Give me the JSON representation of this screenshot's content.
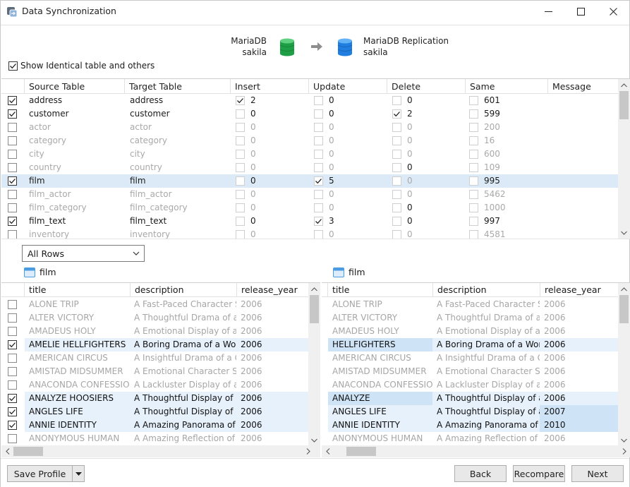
{
  "window": {
    "title": "Data Synchronization"
  },
  "source": {
    "server": "MariaDB",
    "database": "sakila",
    "color": "#1e9f46"
  },
  "target": {
    "server": "MariaDB Replication",
    "database": "sakila",
    "color": "#1f7ee0"
  },
  "show_identical_label": "Show Identical table and others",
  "show_identical_checked": true,
  "table_columns": [
    "Source Table",
    "Target Table",
    "Insert",
    "Update",
    "Delete",
    "Same",
    "Message"
  ],
  "tables": [
    {
      "checked": true,
      "source": "address",
      "target": "address",
      "insert": "2",
      "insert_checked": true,
      "update": "0",
      "update_checked": false,
      "delete": "0",
      "delete_checked": false,
      "same": "601",
      "dim": false,
      "selected": false,
      "delete_dim": false
    },
    {
      "checked": true,
      "source": "customer",
      "target": "customer",
      "insert": "0",
      "insert_checked": false,
      "update": "0",
      "update_checked": false,
      "delete": "2",
      "delete_checked": true,
      "same": "599",
      "dim": false,
      "selected": false,
      "delete_dim": false
    },
    {
      "checked": false,
      "source": "actor",
      "target": "actor",
      "insert": "0",
      "insert_checked": false,
      "update": "0",
      "update_checked": false,
      "delete": "0",
      "delete_checked": false,
      "same": "200",
      "dim": true,
      "selected": false,
      "delete_dim": true
    },
    {
      "checked": false,
      "source": "category",
      "target": "category",
      "insert": "0",
      "insert_checked": false,
      "update": "0",
      "update_checked": false,
      "delete": "0",
      "delete_checked": false,
      "same": "16",
      "dim": true,
      "selected": false,
      "delete_dim": true
    },
    {
      "checked": false,
      "source": "city",
      "target": "city",
      "insert": "0",
      "insert_checked": false,
      "update": "0",
      "update_checked": false,
      "delete": "0",
      "delete_checked": false,
      "same": "600",
      "dim": true,
      "selected": false,
      "delete_dim": true
    },
    {
      "checked": false,
      "source": "country",
      "target": "country",
      "insert": "0",
      "insert_checked": false,
      "update": "0",
      "update_checked": false,
      "delete": "0",
      "delete_checked": false,
      "same": "109",
      "dim": true,
      "selected": false,
      "delete_dim": false
    },
    {
      "checked": true,
      "source": "film",
      "target": "film",
      "insert": "0",
      "insert_checked": false,
      "update": "5",
      "update_checked": true,
      "delete": "0",
      "delete_checked": false,
      "same": "995",
      "dim": false,
      "selected": true,
      "delete_dim": true
    },
    {
      "checked": false,
      "source": "film_actor",
      "target": "film_actor",
      "insert": "0",
      "insert_checked": false,
      "update": "0",
      "update_checked": false,
      "delete": "0",
      "delete_checked": false,
      "same": "5462",
      "dim": true,
      "selected": false,
      "delete_dim": true
    },
    {
      "checked": false,
      "source": "film_category",
      "target": "film_category",
      "insert": "0",
      "insert_checked": false,
      "update": "0",
      "update_checked": false,
      "delete": "0",
      "delete_checked": false,
      "same": "1000",
      "dim": true,
      "selected": false,
      "delete_dim": false
    },
    {
      "checked": true,
      "source": "film_text",
      "target": "film_text",
      "insert": "0",
      "insert_checked": false,
      "update": "3",
      "update_checked": true,
      "delete": "0",
      "delete_checked": false,
      "same": "997",
      "dim": false,
      "selected": false,
      "delete_dim": true
    },
    {
      "checked": false,
      "source": "inventory",
      "target": "inventory",
      "insert": "0",
      "insert_checked": false,
      "update": "0",
      "update_checked": false,
      "delete": "0",
      "delete_checked": false,
      "same": "4581",
      "dim": true,
      "selected": false,
      "delete_dim": true
    }
  ],
  "row_filter": {
    "value": "All Rows"
  },
  "left_panel": {
    "table_name": "film",
    "columns": [
      "title",
      "description",
      "release_year"
    ],
    "rows": [
      {
        "checked": false,
        "on": false,
        "title": "ALONE TRIP",
        "description": "A Fast-Paced Character Stud",
        "release_year": "2006"
      },
      {
        "checked": false,
        "on": false,
        "title": "ALTER VICTORY",
        "description": "A Thoughtful Drama of a Cc",
        "release_year": "2006"
      },
      {
        "checked": false,
        "on": false,
        "title": "AMADEUS HOLY",
        "description": "A Emotional Display of a Pic",
        "release_year": "2006"
      },
      {
        "checked": true,
        "on": true,
        "title": "AMELIE HELLFIGHTERS",
        "description": "A Boring Drama of a Woma",
        "release_year": "2006"
      },
      {
        "checked": false,
        "on": false,
        "title": "AMERICAN CIRCUS",
        "description": "A Insightful Drama of a Girl",
        "release_year": "2006"
      },
      {
        "checked": false,
        "on": false,
        "title": "AMISTAD MIDSUMMER",
        "description": "A Emotional Character Stud",
        "release_year": "2006"
      },
      {
        "checked": false,
        "on": false,
        "title": "ANACONDA CONFESSIO",
        "description": "A Lackluster Display of a D",
        "release_year": "2006"
      },
      {
        "checked": true,
        "on": true,
        "title": "ANALYZE HOOSIERS",
        "description": "A Thoughtful Display of a E",
        "release_year": "2006"
      },
      {
        "checked": true,
        "on": true,
        "title": "ANGLES LIFE",
        "description": "A Thoughtful Display of a W",
        "release_year": "2006"
      },
      {
        "checked": true,
        "on": true,
        "title": "ANNIE IDENTITY",
        "description": "A Amazing Panorama of a P",
        "release_year": "2006"
      },
      {
        "checked": false,
        "on": false,
        "title": "ANONYMOUS HUMAN",
        "description": "A Amazing Reflection of a",
        "release_year": "2006"
      }
    ]
  },
  "right_panel": {
    "table_name": "film",
    "columns": [
      "title",
      "description",
      "release_year"
    ],
    "rows": [
      {
        "on": false,
        "title": "ALONE TRIP",
        "description": "A Fast-Paced Character Stud",
        "release_year": "2006",
        "diff_title": false,
        "diff_year": false
      },
      {
        "on": false,
        "title": "ALTER VICTORY",
        "description": "A Thoughtful Drama of a Cc",
        "release_year": "2006",
        "diff_title": false,
        "diff_year": false
      },
      {
        "on": false,
        "title": "AMADEUS HOLY",
        "description": "A Emotional Display of a Pic",
        "release_year": "2006",
        "diff_title": false,
        "diff_year": false
      },
      {
        "on": true,
        "title": "HELLFIGHTERS",
        "description": "A Boring Drama of a Woma",
        "release_year": "2006",
        "diff_title": true,
        "diff_year": false
      },
      {
        "on": false,
        "title": "AMERICAN CIRCUS",
        "description": "A Insightful Drama of a Girl",
        "release_year": "2006",
        "diff_title": false,
        "diff_year": false
      },
      {
        "on": false,
        "title": "AMISTAD MIDSUMMER",
        "description": "A Emotional Character Stud",
        "release_year": "2006",
        "diff_title": false,
        "diff_year": false
      },
      {
        "on": false,
        "title": "ANACONDA CONFESSIO",
        "description": "A Lackluster Display of a D",
        "release_year": "2006",
        "diff_title": false,
        "diff_year": false
      },
      {
        "on": true,
        "title": "ANALYZE",
        "description": "A Thoughtful Display of a E",
        "release_year": "2006",
        "diff_title": true,
        "diff_year": false
      },
      {
        "on": true,
        "title": "ANGLES LIFE",
        "description": "A Thoughtful Display of a W",
        "release_year": "2007",
        "diff_title": false,
        "diff_year": true
      },
      {
        "on": true,
        "title": "ANNIE IDENTITY",
        "description": "A Amazing Panorama of a P",
        "release_year": "2010",
        "diff_title": false,
        "diff_year": true
      },
      {
        "on": false,
        "title": "ANONYMOUS HUMAN",
        "description": "A Amazing Reflection of a",
        "release_year": "2006",
        "diff_title": false,
        "diff_year": false
      }
    ]
  },
  "footer": {
    "save_profile": "Save Profile",
    "back": "Back",
    "recompare": "Recompare",
    "next": "Next"
  }
}
